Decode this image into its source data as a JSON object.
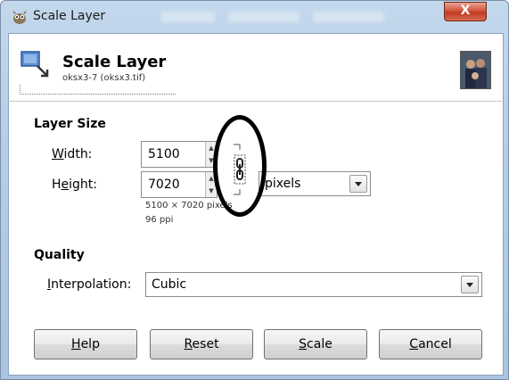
{
  "window": {
    "title": "Scale Layer",
    "close_label": "X"
  },
  "header": {
    "title": "Scale Layer",
    "subtitle": "oksx3-7 (oksx3.tif)"
  },
  "layer_size": {
    "section_label": "Layer Size",
    "width_label_mnemonic": "W",
    "width_label_rest": "idth:",
    "width_value": "5100",
    "height_label_pre": "H",
    "height_label_mnemonic": "e",
    "height_label_rest": "ight:",
    "height_value": "7020",
    "unit": "pixels",
    "info_dimensions": "5100 × 7020 pixels",
    "info_resolution": "96 ppi",
    "chain_linked": true
  },
  "quality": {
    "section_label": "Quality",
    "interp_label_mnemonic": "I",
    "interp_label_rest": "nterpolation:",
    "interpolation": "Cubic"
  },
  "buttons": {
    "help_mnemonic": "H",
    "help_rest": "elp",
    "reset_mnemonic": "R",
    "reset_rest": "eset",
    "scale_mnemonic": "S",
    "scale_rest": "cale",
    "cancel_mnemonic": "C",
    "cancel_rest": "ancel"
  },
  "colors": {
    "annotation": "#000000",
    "close_button": "#c94a30"
  }
}
